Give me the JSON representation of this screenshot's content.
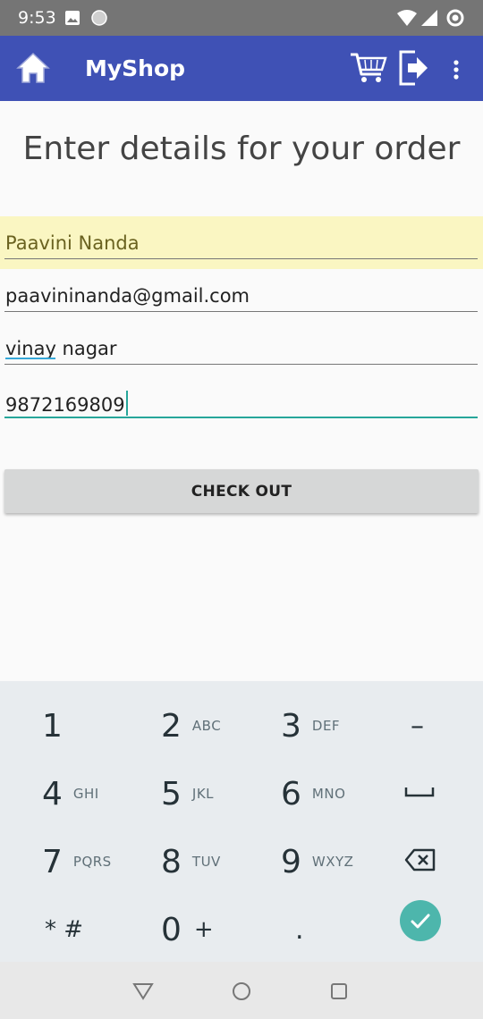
{
  "status_bar": {
    "time": "9:53"
  },
  "app_bar": {
    "title": "MyShop"
  },
  "form": {
    "heading": "Enter details for your order",
    "name_value": "Paavini Nanda",
    "email_value": "paavininanda@gmail.com",
    "address_value": "vinay nagar",
    "phone_value": "9872169809",
    "checkout_label": "CHECK OUT"
  },
  "keypad": {
    "rows": [
      [
        {
          "digit": "1",
          "letters": ""
        },
        {
          "digit": "2",
          "letters": "ABC"
        },
        {
          "digit": "3",
          "letters": "DEF"
        },
        {
          "digit": "–",
          "letters": ""
        }
      ],
      [
        {
          "digit": "4",
          "letters": "GHI"
        },
        {
          "digit": "5",
          "letters": "JKL"
        },
        {
          "digit": "6",
          "letters": "MNO"
        }
      ],
      [
        {
          "digit": "7",
          "letters": "PQRS"
        },
        {
          "digit": "8",
          "letters": "TUV"
        },
        {
          "digit": "9",
          "letters": "WXYZ"
        }
      ],
      [
        {
          "digit": "* #",
          "letters": ""
        },
        {
          "digit": "0",
          "letters": "+"
        },
        {
          "digit": ".",
          "letters": ""
        }
      ]
    ]
  },
  "colors": {
    "app_bar": "#3f51b5",
    "status_bar": "#757575",
    "focus_accent": "#26a69a",
    "highlight_field": "#faf6c2"
  },
  "icons": [
    "image-icon",
    "circle-icon",
    "wifi-icon",
    "signal-icon",
    "data-saver-icon",
    "home-icon",
    "cart-icon",
    "logout-icon",
    "overflow-menu-icon",
    "space-icon",
    "backspace-icon",
    "done-check-icon",
    "nav-back-icon",
    "nav-home-icon",
    "nav-recents-icon"
  ]
}
